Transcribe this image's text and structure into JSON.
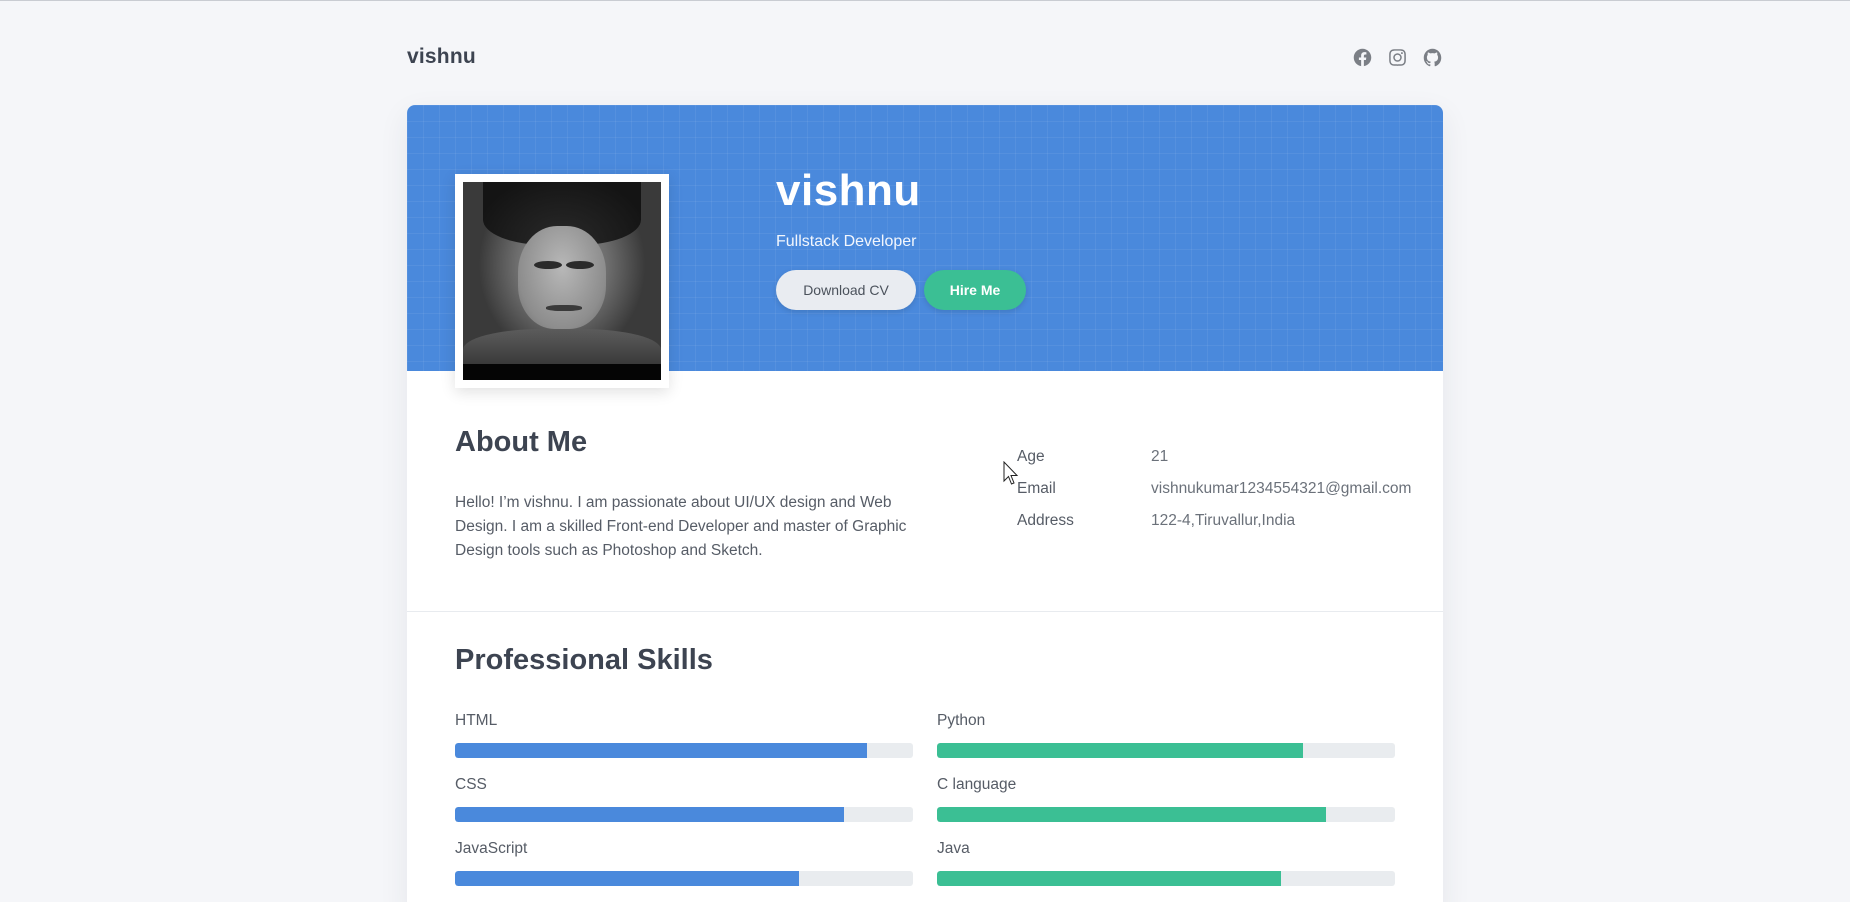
{
  "header": {
    "brand": "vishnu",
    "social_icons": [
      "facebook-icon",
      "instagram-icon",
      "github-icon"
    ]
  },
  "hero": {
    "name": "vishnu",
    "role": "Fullstack Developer",
    "download_cv_label": "Download CV",
    "hire_me_label": "Hire Me",
    "photo_alt": "profile photo"
  },
  "about": {
    "title": "About Me",
    "text": "Hello! I’m vishnu. I am passionate about UI/UX design and Web Design. I am a skilled Front-end Developer and master of Graphic Design tools such as Photoshop and Sketch.",
    "info": [
      {
        "key": "Age",
        "value": "21"
      },
      {
        "key": "Email",
        "value": "vishnukumar1234554321@gmail.com"
      },
      {
        "key": "Address",
        "value": "122-4,Tiruvallur,India"
      }
    ]
  },
  "skills": {
    "title": "Professional Skills",
    "left": [
      {
        "name": "HTML",
        "level": 0.9
      },
      {
        "name": "CSS",
        "level": 0.85
      },
      {
        "name": "JavaScript",
        "level": 0.75
      }
    ],
    "right": [
      {
        "name": "Python",
        "level": 0.8
      },
      {
        "name": "C language",
        "level": 0.85
      },
      {
        "name": "Java",
        "level": 0.75
      }
    ]
  },
  "colors": {
    "primary": "#4a89dc",
    "accent": "#3bbf94",
    "background": "#f5f6f9"
  }
}
